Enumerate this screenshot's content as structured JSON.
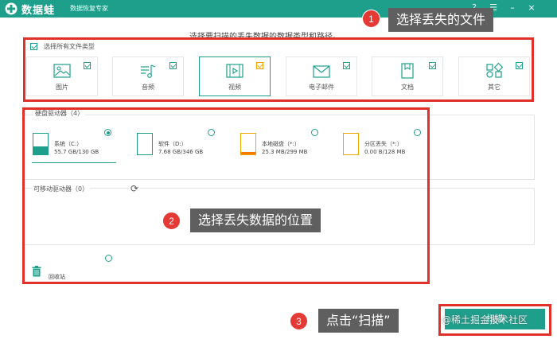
{
  "titlebar": {
    "app_name": "数据蛙",
    "subtitle": "数据恢复专家",
    "controls": [
      "?",
      "☰",
      "–",
      "×"
    ]
  },
  "callouts": [
    {
      "number": "1",
      "text": "选择丢失的文件"
    },
    {
      "number": "2",
      "text": "选择丢失数据的位置"
    },
    {
      "number": "3",
      "text": "点击“扫描”"
    }
  ],
  "instruction": "选择要扫描的丢失数据的数据类型和路径。",
  "file_types": {
    "select_all_label": "选择所有文件类型",
    "items": [
      {
        "label": "图片",
        "icon": "image-icon",
        "checked": true,
        "active": false
      },
      {
        "label": "音频",
        "icon": "music-icon",
        "checked": true,
        "active": false
      },
      {
        "label": "视频",
        "icon": "video-icon",
        "checked": true,
        "active": true
      },
      {
        "label": "电子邮件",
        "icon": "mail-icon",
        "checked": true,
        "active": false
      },
      {
        "label": "文档",
        "icon": "document-icon",
        "checked": true,
        "active": false
      },
      {
        "label": "其它",
        "icon": "other-icon",
        "checked": true,
        "active": false
      }
    ]
  },
  "hard_drives": {
    "title": "硬盘驱动器（4）",
    "items": [
      {
        "name": "系统（C:）",
        "size": "55.7 GB/130 GB",
        "selected": true
      },
      {
        "name": "软件（D:）",
        "size": "7.68 GB/346 GB",
        "selected": false
      },
      {
        "name": "本地磁盘（*:）",
        "size": "25.3 MB/299 MB",
        "selected": false
      },
      {
        "name": "分区丢失（*:）",
        "size": "0.00  B/128 MB",
        "selected": false
      }
    ]
  },
  "removable": {
    "title": "可移动驱动器（0）"
  },
  "recycle_bin": {
    "label": "回收站"
  },
  "scan_button": "扫描",
  "watermark": "@稀土掘金技术社区",
  "colors": {
    "brand": "#1e9f8c",
    "callout_red": "#e53935",
    "callout_bg": "#5f5f5f"
  }
}
